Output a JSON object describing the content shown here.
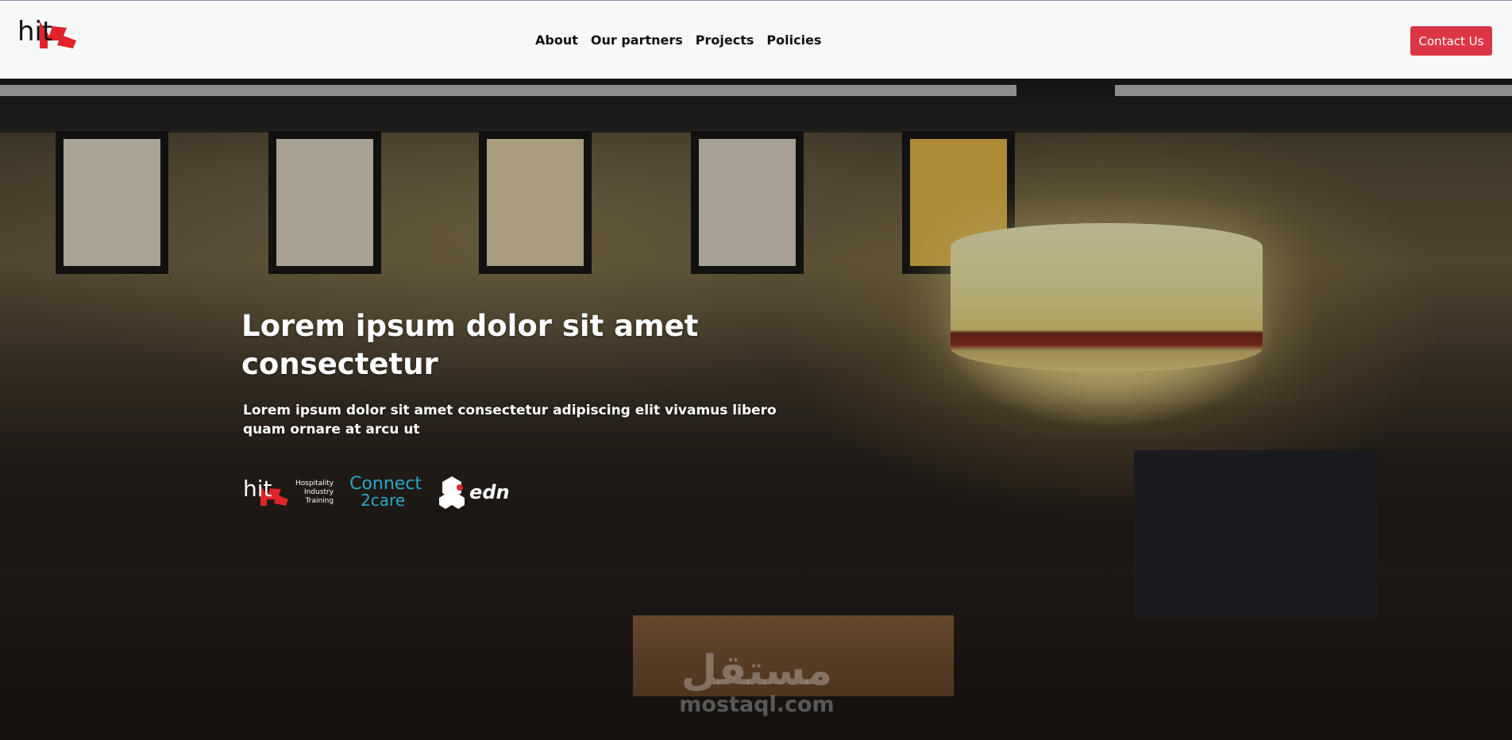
{
  "nav": {
    "logo_text": "hit",
    "links": [
      {
        "label": "About"
      },
      {
        "label": "Our partners"
      },
      {
        "label": "Projects"
      },
      {
        "label": "Policies"
      }
    ],
    "contact_label": "Contact Us"
  },
  "hero": {
    "title": "Lorem ipsum dolor sit amet consectetur",
    "subtitle": "Lorem ipsum dolor sit amet consectetur adipiscing elit vivamus libero quam ornare at arcu ut",
    "partners": {
      "hit": {
        "name": "hit",
        "tagline": [
          "Hospitality",
          "Industry",
          "Training"
        ]
      },
      "connect2care": {
        "line1": "Connect",
        "line2": "2care"
      },
      "edn": {
        "name": "edn"
      }
    }
  },
  "watermark": {
    "arabic": "مستقل",
    "domain": "mostaql.com"
  },
  "colors": {
    "accent": "#dc3545",
    "nav_bg": "#f7f8f8",
    "logo_red": "#e0242c",
    "c2c_blue": "#2aa9c7"
  }
}
